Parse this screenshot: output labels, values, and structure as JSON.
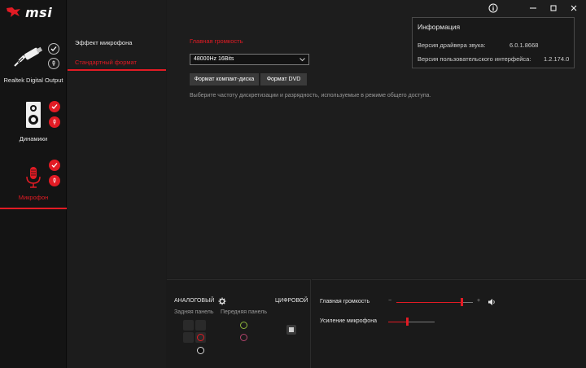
{
  "app": {
    "logo_text": "msi"
  },
  "devices": [
    {
      "label": "Realtek Digital Output",
      "icon": "digital-output-cable-icon",
      "status": "grey",
      "active": false
    },
    {
      "label": "Динамики",
      "icon": "speaker-icon",
      "status": "red",
      "active": false
    },
    {
      "label": "Микрофон",
      "icon": "microphone-icon",
      "status": "red",
      "active": true
    }
  ],
  "submenu": {
    "items": [
      {
        "label": "Эффект микрофона",
        "active": false
      },
      {
        "label": "Стандартный формат",
        "active": true
      }
    ]
  },
  "main": {
    "section_title": "Главная громкость",
    "format_select_value": "48000Hz 16Bits",
    "btn_cd": "Формат компакт-диска",
    "btn_dvd": "Формат DVD",
    "hint": "Выберите частоту дискретизации и разрядность, используемые в режиме общего доступа."
  },
  "info": {
    "title": "Информация",
    "driver_label": "Версия драйвера звука:",
    "driver_value": "6.0.1.8668",
    "ui_label": "Версия пользовательского интерфейса:",
    "ui_value": "1.2.174.0"
  },
  "bottom": {
    "analog_label": "АНАЛОГОВЫЙ",
    "digital_label": "ЦИФРОВОЙ",
    "rear_panel": "Задняя панель",
    "front_panel": "Передняя панель",
    "main_volume_label": "Главная громкость",
    "minus": "−",
    "plus": "+",
    "mic_boost_label": "Усиление микрофона",
    "main_volume_level": 0.85,
    "mic_boost_level": 0.4
  },
  "colors": {
    "accent": "#e21b24",
    "background": "#1a1a1a",
    "jack_green": "#8db43c",
    "jack_pink": "#b3446d",
    "jack_red": "#e21b24"
  }
}
